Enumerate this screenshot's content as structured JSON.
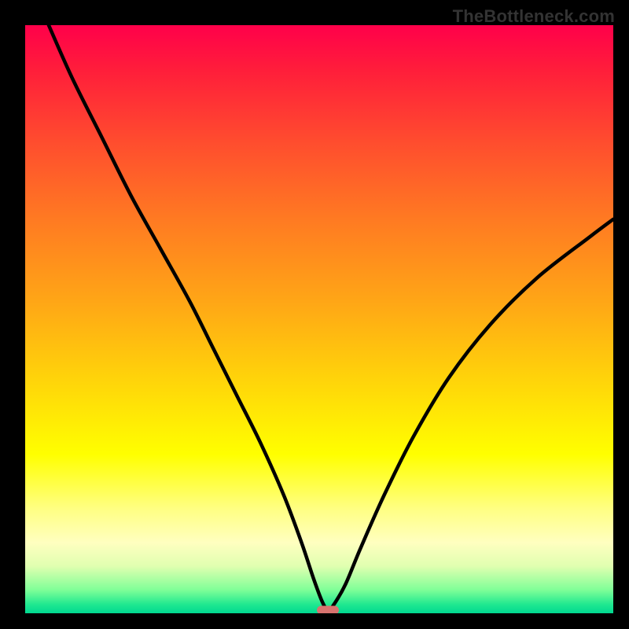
{
  "watermark": "TheBottleneck.com",
  "chart_data": {
    "type": "line",
    "title": "",
    "xlabel": "",
    "ylabel": "",
    "xlim": [
      0,
      100
    ],
    "ylim": [
      0,
      100
    ],
    "series": [
      {
        "name": "bottleneck-curve",
        "x": [
          4,
          8,
          13,
          18,
          23,
          28,
          32,
          36,
          40,
          44,
          47,
          49,
          50.5,
          51.5,
          52.5,
          54.5,
          57,
          61,
          66,
          72,
          79,
          87,
          96,
          100
        ],
        "y": [
          100,
          91,
          81,
          71,
          62,
          53,
          45,
          37,
          29,
          20,
          12,
          6,
          2,
          0.5,
          1.5,
          5,
          11,
          20,
          30,
          40,
          49,
          57,
          64,
          67
        ]
      }
    ],
    "minimum_point": {
      "x": 51.5,
      "y": 0.5
    },
    "gradient_colors": {
      "top": "#ff004a",
      "mid": "#ffff00",
      "bottom": "#00d890"
    },
    "marker_color": "#d8736f"
  }
}
